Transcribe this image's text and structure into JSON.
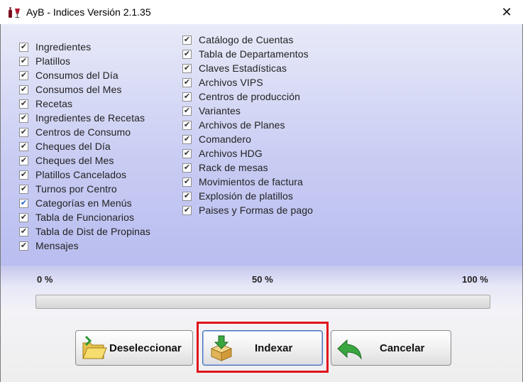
{
  "window": {
    "title": "AyB - Indices Versión 2.1.35",
    "close_glyph": "✕"
  },
  "checks_left": [
    {
      "label": "Ingredientes",
      "checked": true
    },
    {
      "label": "Platillos",
      "checked": true
    },
    {
      "label": "Consumos del Día",
      "checked": true
    },
    {
      "label": "Consumos del Mes",
      "checked": true
    },
    {
      "label": "Recetas",
      "checked": true
    },
    {
      "label": "Ingredientes de Recetas",
      "checked": true
    },
    {
      "label": "Centros de Consumo",
      "checked": true
    },
    {
      "label": "Cheques del Día",
      "checked": true
    },
    {
      "label": "Cheques del Mes",
      "checked": true
    },
    {
      "label": "Platillos Cancelados",
      "checked": true
    },
    {
      "label": "Turnos por Centro",
      "checked": true
    },
    {
      "label": "Categorías en Menús",
      "checked": true,
      "accent": true
    },
    {
      "label": "Tabla de Funcionarios",
      "checked": true
    },
    {
      "label": "Tabla de Dist de Propinas",
      "checked": true
    },
    {
      "label": "Mensajes",
      "checked": true
    }
  ],
  "checks_right": [
    {
      "label": "Catálogo de Cuentas",
      "checked": true
    },
    {
      "label": "Tabla de Departamentos",
      "checked": true
    },
    {
      "label": "Claves Estadísticas",
      "checked": true
    },
    {
      "label": "Archivos VIPS",
      "checked": true
    },
    {
      "label": "Centros de producción",
      "checked": true
    },
    {
      "label": "Variantes",
      "checked": true
    },
    {
      "label": "Archivos de Planes",
      "checked": true
    },
    {
      "label": "Comandero",
      "checked": true
    },
    {
      "label": "Archivos HDG",
      "checked": true
    },
    {
      "label": "Rack de mesas",
      "checked": true
    },
    {
      "label": "Movimientos de factura",
      "checked": true
    },
    {
      "label": "Explosión de platillos",
      "checked": true
    },
    {
      "label": "Paises y Formas de pago",
      "checked": true
    }
  ],
  "progress": {
    "label_start": "0 %",
    "label_mid": "50 %",
    "label_end": "100 %",
    "value": 0
  },
  "buttons": {
    "deselect": "Deseleccionar",
    "index": "Indexar",
    "cancel": "Cancelar"
  },
  "colors": {
    "highlight": "#e0141a",
    "check_accent": "#1a5fc8"
  }
}
